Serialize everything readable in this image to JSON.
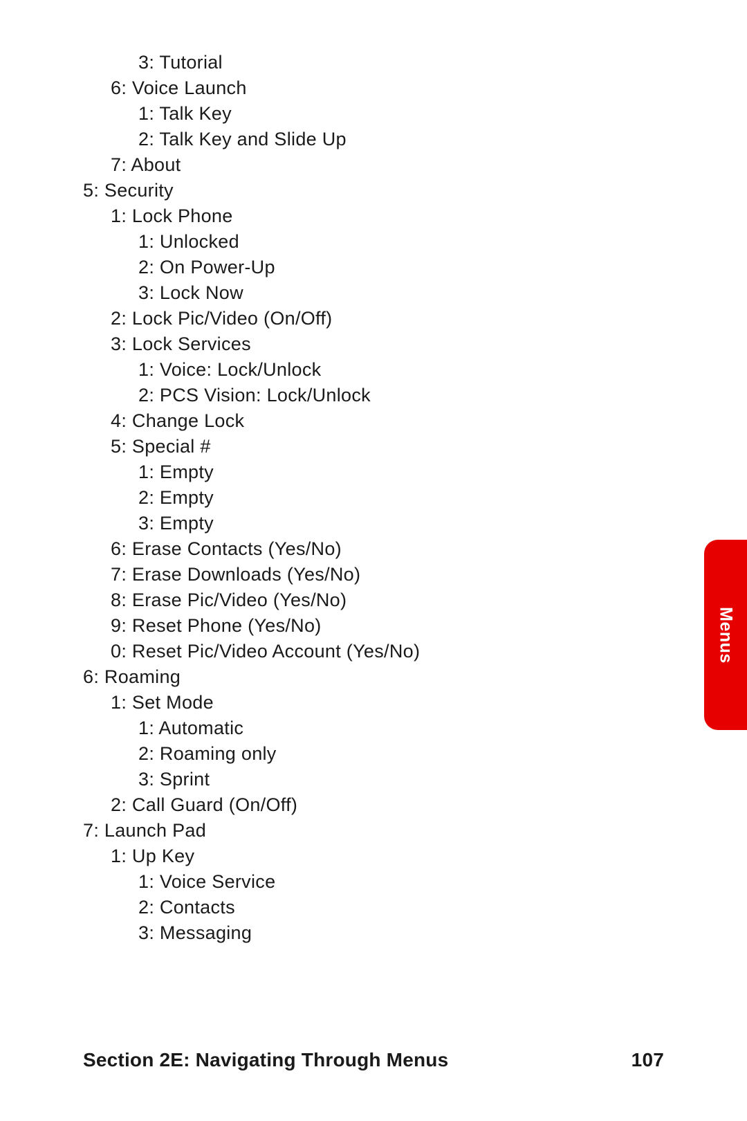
{
  "tab_label": "Menus",
  "footer": {
    "section": "Section 2E: Navigating Through Menus",
    "page": "107"
  },
  "items": [
    {
      "lvl": 2,
      "text": "3: Tutorial"
    },
    {
      "lvl": 1,
      "text": "6: Voice Launch"
    },
    {
      "lvl": 2,
      "text": "1: Talk Key"
    },
    {
      "lvl": 2,
      "text": "2: Talk Key and Slide Up"
    },
    {
      "lvl": 1,
      "text": "7: About"
    },
    {
      "lvl": 0,
      "text": "5: Security"
    },
    {
      "lvl": 1,
      "text": "1: Lock Phone"
    },
    {
      "lvl": 2,
      "text": "1: Unlocked"
    },
    {
      "lvl": 2,
      "text": "2: On Power-Up"
    },
    {
      "lvl": 2,
      "text": "3: Lock Now"
    },
    {
      "lvl": 1,
      "text": "2: Lock Pic/Video (On/Off)"
    },
    {
      "lvl": 1,
      "text": "3: Lock Services"
    },
    {
      "lvl": 2,
      "text": "1: Voice: Lock/Unlock"
    },
    {
      "lvl": 2,
      "text": "2: PCS Vision: Lock/Unlock"
    },
    {
      "lvl": 1,
      "text": "4: Change Lock"
    },
    {
      "lvl": 1,
      "text": "5: Special #"
    },
    {
      "lvl": 2,
      "text": "1: Empty"
    },
    {
      "lvl": 2,
      "text": "2: Empty"
    },
    {
      "lvl": 2,
      "text": "3: Empty"
    },
    {
      "lvl": 1,
      "text": "6: Erase Contacts (Yes/No)"
    },
    {
      "lvl": 1,
      "text": "7: Erase Downloads (Yes/No)"
    },
    {
      "lvl": 1,
      "text": "8: Erase Pic/Video (Yes/No)"
    },
    {
      "lvl": 1,
      "text": "9: Reset Phone (Yes/No)"
    },
    {
      "lvl": 1,
      "text": "0: Reset Pic/Video Account (Yes/No)"
    },
    {
      "lvl": 0,
      "text": "6: Roaming"
    },
    {
      "lvl": 1,
      "text": "1: Set Mode"
    },
    {
      "lvl": 2,
      "text": "1: Automatic"
    },
    {
      "lvl": 2,
      "text": "2: Roaming only"
    },
    {
      "lvl": 2,
      "text": "3: Sprint"
    },
    {
      "lvl": 1,
      "text": "2: Call Guard (On/Off)"
    },
    {
      "lvl": 0,
      "text": "7: Launch Pad"
    },
    {
      "lvl": 1,
      "text": "1: Up Key"
    },
    {
      "lvl": 2,
      "text": "1: Voice Service"
    },
    {
      "lvl": 2,
      "text": "2: Contacts"
    },
    {
      "lvl": 2,
      "text": "3: Messaging"
    }
  ]
}
